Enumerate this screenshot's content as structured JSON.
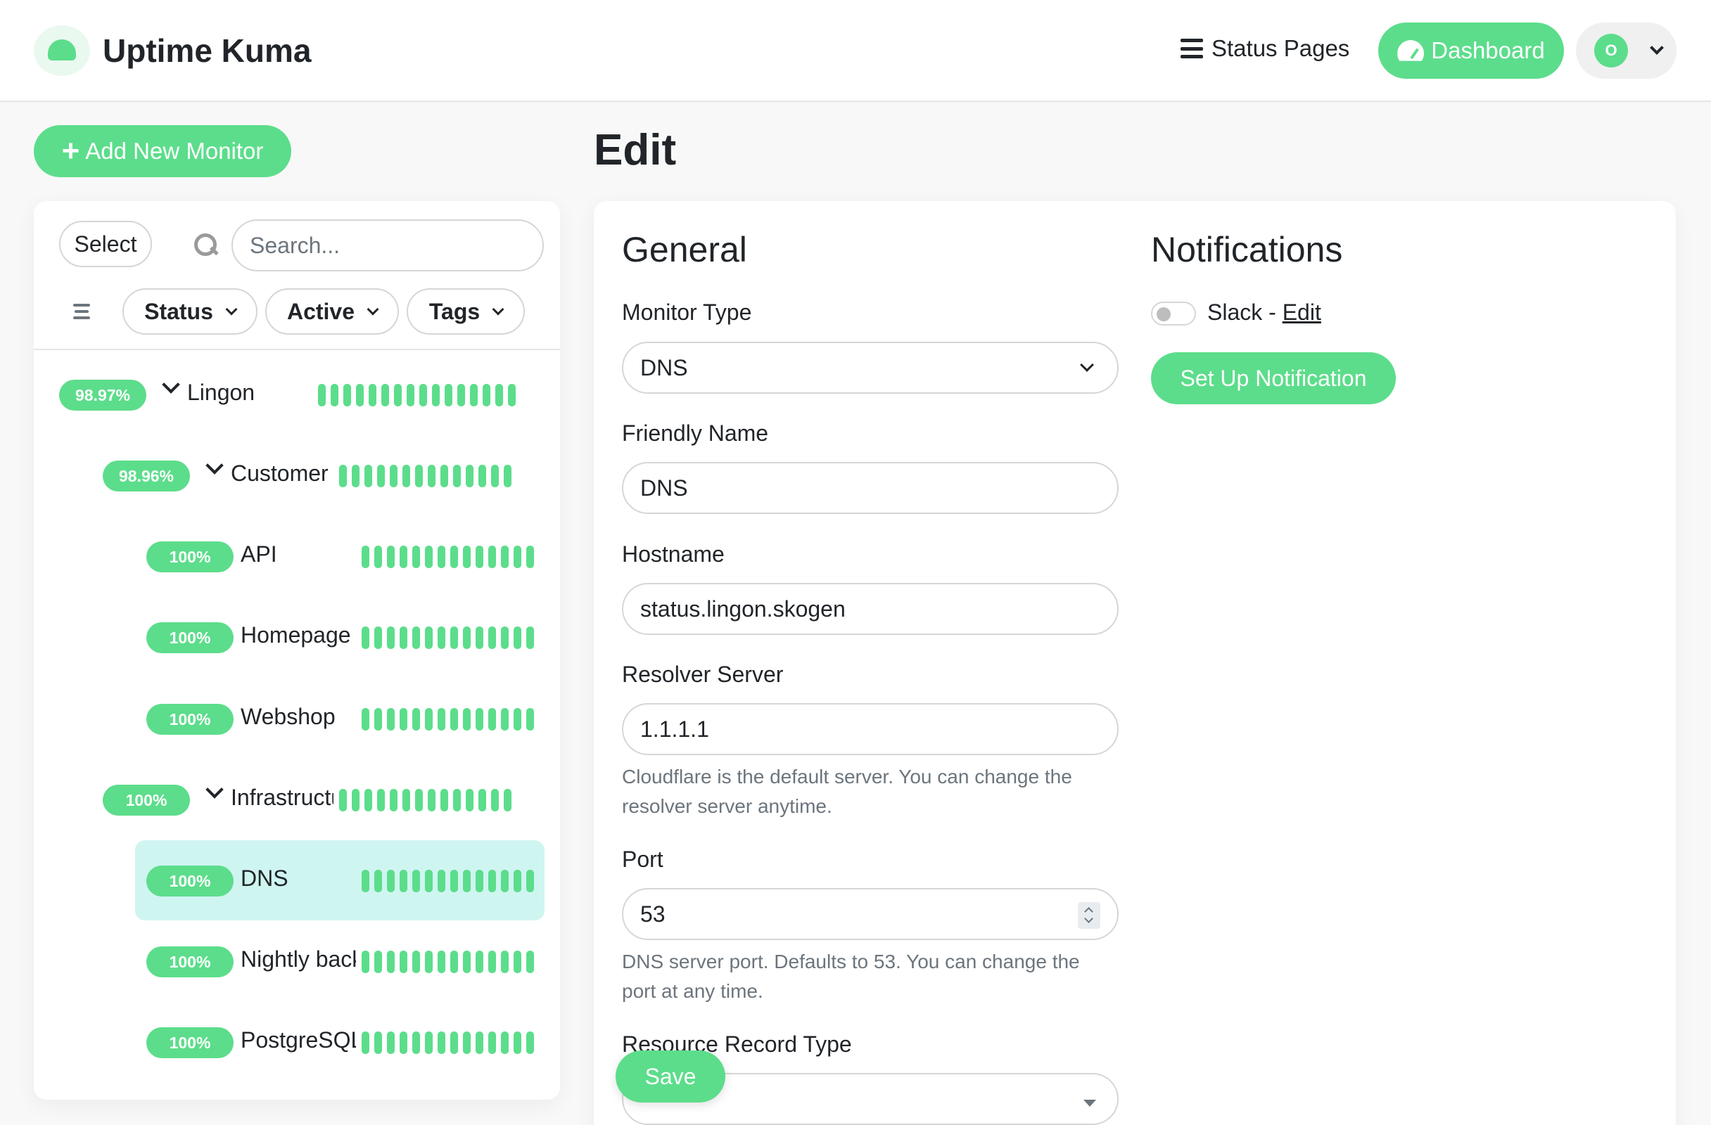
{
  "header": {
    "brand": "Uptime Kuma",
    "status_pages": "Status Pages",
    "dashboard": "Dashboard",
    "avatar_initial": "O"
  },
  "sidebar": {
    "add_monitor": "Add New Monitor",
    "select": "Select",
    "search_placeholder": "Search...",
    "filters": {
      "status": "Status",
      "active": "Active",
      "tags": "Tags"
    },
    "monitors": [
      {
        "badge": "98.97%",
        "name": "Lingon",
        "group": true,
        "level": 0,
        "beats": 16
      },
      {
        "badge": "98.96%",
        "name": "Customer",
        "group": true,
        "level": 1,
        "beats": 14
      },
      {
        "badge": "100%",
        "name": "API",
        "group": false,
        "level": 2,
        "beats": 14
      },
      {
        "badge": "100%",
        "name": "Homepage",
        "group": false,
        "level": 2,
        "beats": 14
      },
      {
        "badge": "100%",
        "name": "Webshop",
        "group": false,
        "level": 2,
        "beats": 14
      },
      {
        "badge": "100%",
        "name": "Infrastructure",
        "group": true,
        "level": 1,
        "beats": 14
      },
      {
        "badge": "100%",
        "name": "DNS",
        "group": false,
        "level": 2,
        "beats": 14,
        "selected": true
      },
      {
        "badge": "100%",
        "name": "Nightly backup",
        "group": false,
        "level": 2,
        "beats": 14
      },
      {
        "badge": "100%",
        "name": "PostgreSQL",
        "group": false,
        "level": 2,
        "beats": 14
      }
    ]
  },
  "edit": {
    "title": "Edit",
    "general_title": "General",
    "monitor_type": {
      "label": "Monitor Type",
      "value": "DNS"
    },
    "friendly_name": {
      "label": "Friendly Name",
      "value": "DNS"
    },
    "hostname": {
      "label": "Hostname",
      "value": "status.lingon.skogen"
    },
    "resolver": {
      "label": "Resolver Server",
      "value": "1.1.1.1",
      "help": "Cloudflare is the default server. You can change the resolver server anytime."
    },
    "port": {
      "label": "Port",
      "value": "53",
      "help": "DNS server port. Defaults to 53. You can change the port at any time."
    },
    "record_type": {
      "label": "Resource Record Type",
      "value": ""
    },
    "save": "Save"
  },
  "notifications": {
    "title": "Notifications",
    "slack": "Slack - ",
    "edit_link": "Edit",
    "setup": "Set Up Notification"
  },
  "colors": {
    "accent": "#5cdd8b",
    "selected_row": "#cff5f1"
  }
}
